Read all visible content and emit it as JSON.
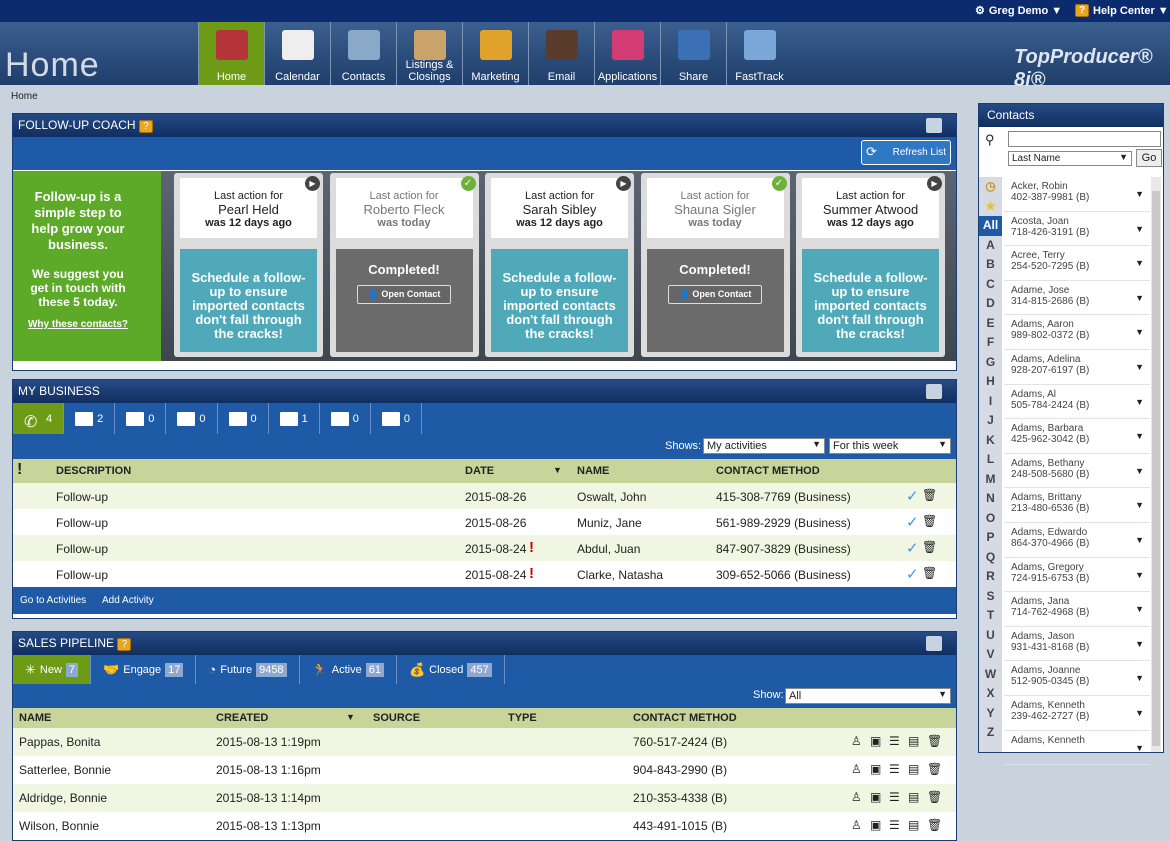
{
  "top": {
    "user": "Greg Demo ▼",
    "help": "Help Center ▼"
  },
  "header": {
    "page_title": "Home",
    "brand": "TopProducer® 8i®"
  },
  "nav": [
    {
      "label": "Home",
      "icon": "home-icon",
      "color": "#b5343a"
    },
    {
      "label": "Calendar",
      "icon": "calendar-icon",
      "color": "#eeeeee"
    },
    {
      "label": "Contacts",
      "icon": "contacts-icon",
      "color": "#8aa9c8"
    },
    {
      "label": "Listings &\nClosings",
      "icon": "listings-icon",
      "color": "#c9a36a"
    },
    {
      "label": "Marketing",
      "icon": "marketing-icon",
      "color": "#e0a22a"
    },
    {
      "label": "Email",
      "icon": "email-icon",
      "color": "#5a3c2c"
    },
    {
      "label": "Applications",
      "icon": "applications-icon",
      "color": "#d33b73"
    },
    {
      "label": "Share",
      "icon": "share-icon",
      "color": "#3b6fb6"
    },
    {
      "label": "FastTrack",
      "icon": "fasttrack-icon",
      "color": "#7aa7d8"
    }
  ],
  "breadcrumb": "Home",
  "followup": {
    "title": "FOLLOW-UP COACH",
    "refresh": "Refresh List",
    "intro": "Follow-up is a simple step to help grow your business.",
    "suggest": "We suggest you get in touch with these 5 today.",
    "why": "Why these contacts?",
    "cards": [
      {
        "last": "Last action for",
        "name": "Pearl Held",
        "when": "was 12 days ago",
        "msg": "Schedule a follow-up to ensure imported contacts don't fall through the cracks!",
        "done": false
      },
      {
        "last": "Last action for",
        "name": "Roberto Fleck",
        "when": "was today",
        "msg": "Completed!",
        "btn": "Open Contact",
        "done": true
      },
      {
        "last": "Last action for",
        "name": "Sarah Sibley",
        "when": "was 12 days ago",
        "msg": "Schedule a follow-up to ensure imported contacts don't fall through the cracks!",
        "done": false
      },
      {
        "last": "Last action for",
        "name": "Shauna Sigler",
        "when": "was today",
        "msg": "Completed!",
        "btn": "Open Contact",
        "done": true
      },
      {
        "last": "Last action for",
        "name": "Summer Atwood",
        "when": "was 12 days ago",
        "msg": "Schedule a follow-up to ensure imported contacts don't fall through the cracks!",
        "done": false
      }
    ]
  },
  "business": {
    "title": "MY BUSINESS",
    "tabs": [
      {
        "icon": "phone-icon",
        "count": "4"
      },
      {
        "icon": "calendar-icon",
        "count": "2"
      },
      {
        "icon": "task-icon",
        "count": "0"
      },
      {
        "icon": "listing-icon",
        "count": "0"
      },
      {
        "icon": "sold-icon",
        "count": "0"
      },
      {
        "icon": "email-icon",
        "count": "1"
      },
      {
        "icon": "print-icon",
        "count": "0"
      },
      {
        "icon": "event-icon",
        "count": "0"
      }
    ],
    "shows": "Shows:",
    "filter1": "My activities",
    "filter2": "For this week",
    "cols": {
      "flag": "!",
      "desc": "DESCRIPTION",
      "date": "DATE",
      "name": "NAME",
      "method": "CONTACT METHOD"
    },
    "rows": [
      {
        "desc": "Follow-up",
        "date": "2015-08-26",
        "name": "Oswalt, John",
        "method": "415-308-7769 (Business)",
        "urgent": false
      },
      {
        "desc": "Follow-up",
        "date": "2015-08-26",
        "name": "Muniz, Jane",
        "method": "561-989-2929 (Business)",
        "urgent": false
      },
      {
        "desc": "Follow-up",
        "date": "2015-08-24",
        "name": "Abdul, Juan",
        "method": "847-907-3829 (Business)",
        "urgent": true
      },
      {
        "desc": "Follow-up",
        "date": "2015-08-24",
        "name": "Clarke, Natasha",
        "method": "309-652-5066 (Business)",
        "urgent": true
      }
    ],
    "foot": {
      "goto": "Go to Activities",
      "add": "Add Activity"
    }
  },
  "pipeline": {
    "title": "SALES PIPELINE",
    "tabs": [
      {
        "label": "New",
        "count": "7",
        "icon": "burst-icon"
      },
      {
        "label": "Engage",
        "count": "17",
        "icon": "handshake-icon"
      },
      {
        "label": "Future",
        "count": "9458",
        "icon": "clock-icon"
      },
      {
        "label": "Active",
        "count": "61",
        "icon": "runner-icon"
      },
      {
        "label": "Closed",
        "count": "457",
        "icon": "moneybag-icon"
      }
    ],
    "show": "Show:",
    "filter": "All",
    "cols": {
      "name": "NAME",
      "created": "CREATED",
      "source": "SOURCE",
      "type": "TYPE",
      "method": "CONTACT METHOD"
    },
    "rows": [
      {
        "name": "Pappas, Bonita",
        "created": "2015-08-13 1:19pm",
        "method": "760-517-2424 (B)"
      },
      {
        "name": "Satterlee, Bonnie",
        "created": "2015-08-13 1:16pm",
        "method": "904-843-2990 (B)"
      },
      {
        "name": "Aldridge, Bonnie",
        "created": "2015-08-13 1:14pm",
        "method": "210-353-4338 (B)"
      },
      {
        "name": "Wilson, Bonnie",
        "created": "2015-08-13 1:13pm",
        "method": "443-491-1015 (B)"
      }
    ]
  },
  "contacts": {
    "title": "Contacts",
    "search_placeholder": "",
    "sort": "Last Name",
    "go": "Go",
    "letters": [
      "All",
      "A",
      "B",
      "C",
      "D",
      "E",
      "F",
      "G",
      "H",
      "I",
      "J",
      "K",
      "L",
      "M",
      "N",
      "O",
      "P",
      "Q",
      "R",
      "S",
      "T",
      "U",
      "V",
      "W",
      "X",
      "Y",
      "Z"
    ],
    "list": [
      {
        "name": "Acker, Robin",
        "phone": "402-387-9981 (B)"
      },
      {
        "name": "Acosta, Joan",
        "phone": "718-426-3191 (B)"
      },
      {
        "name": "Acree, Terry",
        "phone": "254-520-7295 (B)"
      },
      {
        "name": "Adame, Jose",
        "phone": "314-815-2686 (B)"
      },
      {
        "name": "Adams, Aaron",
        "phone": "989-802-0372 (B)"
      },
      {
        "name": "Adams, Adelina",
        "phone": "928-207-6197 (B)"
      },
      {
        "name": "Adams, Al",
        "phone": "505-784-2424 (B)"
      },
      {
        "name": "Adams, Barbara",
        "phone": "425-962-3042 (B)"
      },
      {
        "name": "Adams, Bethany",
        "phone": "248-508-5680 (B)"
      },
      {
        "name": "Adams, Brittany",
        "phone": "213-480-6536 (B)"
      },
      {
        "name": "Adams, Edwardo",
        "phone": "864-370-4966 (B)"
      },
      {
        "name": "Adams, Gregory",
        "phone": "724-915-6753 (B)"
      },
      {
        "name": "Adams, Jana",
        "phone": "714-762-4968 (B)"
      },
      {
        "name": "Adams, Jason",
        "phone": "931-431-8168 (B)"
      },
      {
        "name": "Adams, Joanne",
        "phone": "512-905-0345 (B)"
      },
      {
        "name": "Adams, Kenneth",
        "phone": "239-462-2727 (B)"
      },
      {
        "name": "Adams, Kenneth",
        "phone": ""
      }
    ]
  }
}
